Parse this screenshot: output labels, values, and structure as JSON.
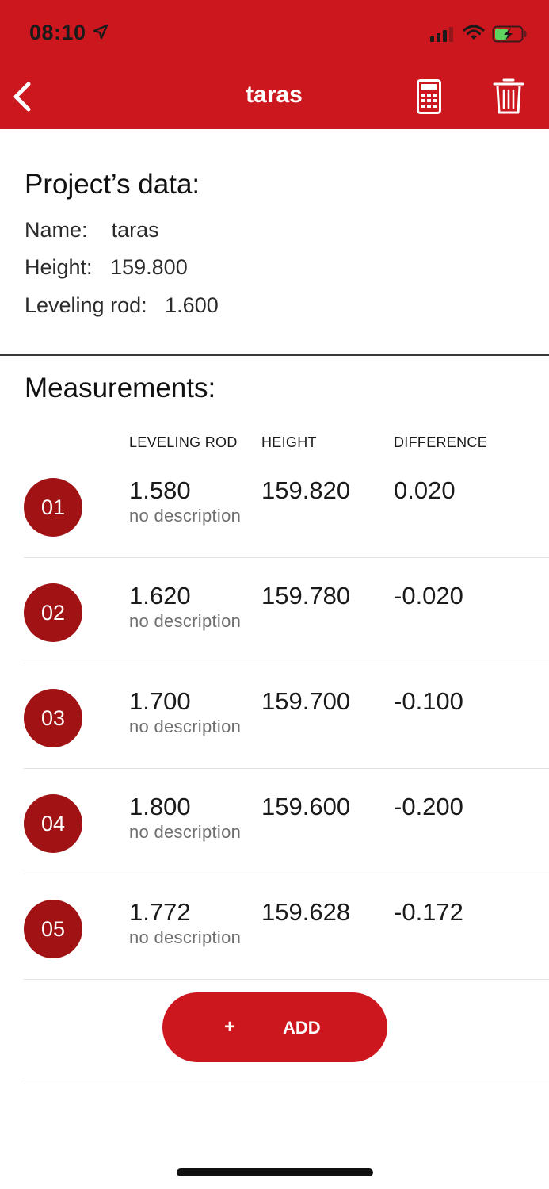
{
  "status_bar": {
    "time": "08:10"
  },
  "nav": {
    "title": "taras"
  },
  "project": {
    "heading": "Project’s data:",
    "name_label": "Name:",
    "name_value": "taras",
    "height_label": "Height:",
    "height_value": "159.800",
    "rod_label": "Leveling rod:",
    "rod_value": "1.600"
  },
  "measurements": {
    "heading": "Measurements:",
    "columns": [
      "LEVELING ROD",
      "HEIGHT",
      "DIFFERENCE"
    ],
    "rows": [
      {
        "num": "01",
        "rod": "1.580",
        "height": "159.820",
        "difference": "0.020",
        "description": "no description"
      },
      {
        "num": "02",
        "rod": "1.620",
        "height": "159.780",
        "difference": "-0.020",
        "description": "no description"
      },
      {
        "num": "03",
        "rod": "1.700",
        "height": "159.700",
        "difference": "-0.100",
        "description": "no description"
      },
      {
        "num": "04",
        "rod": "1.800",
        "height": "159.600",
        "difference": "-0.200",
        "description": "no description"
      },
      {
        "num": "05",
        "rod": "1.772",
        "height": "159.628",
        "difference": "-0.172",
        "description": "no description"
      }
    ]
  },
  "add_button": {
    "plus": "+",
    "label": "ADD"
  },
  "icons": [
    "location-arrow-icon",
    "signal-icon",
    "wifi-icon",
    "battery-charging-icon",
    "back-chevron-icon",
    "calculator-icon",
    "trash-icon"
  ],
  "colors": {
    "brand_red": "#cc171e",
    "badge_red": "#a01213",
    "battery_green": "#5fd35f"
  }
}
